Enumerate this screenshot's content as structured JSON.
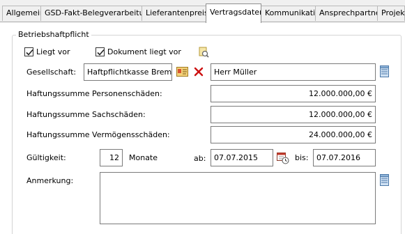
{
  "tabs": [
    {
      "label": "Allgemein"
    },
    {
      "label": "GSD-Fakt-Belegverarbeitung"
    },
    {
      "label": "Lieferantenpreise"
    },
    {
      "label": "Vertragsdaten"
    },
    {
      "label": "Kommunikation"
    },
    {
      "label": "Ansprechpartner"
    },
    {
      "label": "Projekte"
    }
  ],
  "active_tab": "Vertragsdaten",
  "section": {
    "title": "Betriebshaftpflicht"
  },
  "checks": {
    "liegt_vor": {
      "label": "Liegt vor",
      "checked": true
    },
    "dokument": {
      "label": "Dokument liegt vor",
      "checked": true
    }
  },
  "form": {
    "gesellschaft_label": "Gesellschaft:",
    "gesellschaft_value": "Haftpflichtkasse Bremen",
    "contact_value": "Herr Müller",
    "personen_label": "Haftungssumme Personenschäden:",
    "personen_value": "12.000.000,00 €",
    "sach_label": "Haftungssumme Sachschäden:",
    "sach_value": "12.000.000,00 €",
    "vermoegen_label": "Haftungssumme Vermögensschäden:",
    "vermoegen_value": "24.000.000,00 €",
    "gueltigkeit_label": "Gültigkeit:",
    "gueltigkeit_value": "12",
    "monate_label": "Monate",
    "ab_label": "ab:",
    "ab_value": "07.07.2015",
    "bis_label": "bis:",
    "bis_value": "07.07.2016",
    "anmerkung_label": "Anmerkung:",
    "anmerkung_value": ""
  },
  "colors": {
    "delete_red": "#cc1111",
    "calendar_red": "#c0392b",
    "notepad_blue": "#8fb4d9"
  }
}
